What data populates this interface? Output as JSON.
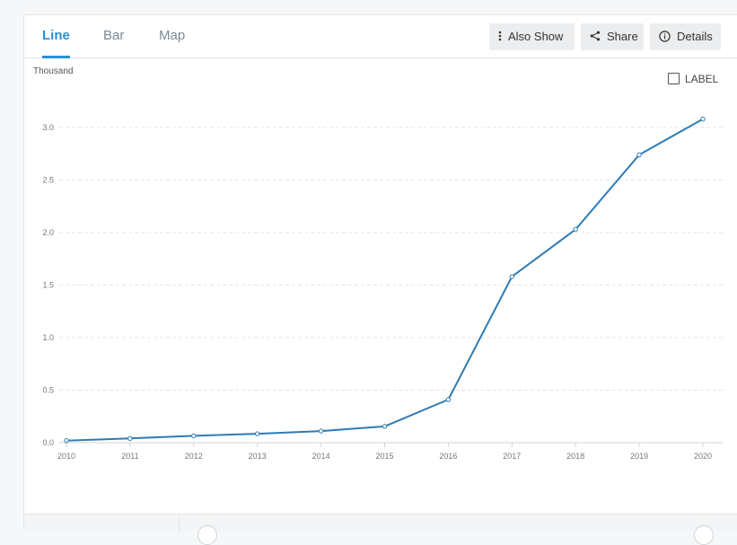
{
  "tabs": [
    {
      "label": "Line",
      "active": true
    },
    {
      "label": "Bar",
      "active": false
    },
    {
      "label": "Map",
      "active": false
    }
  ],
  "toolbar": {
    "also_show_label": "Also Show",
    "also_show_icon": "vertical-dots-icon",
    "share_label": "Share",
    "share_icon": "share-icon",
    "details_label": "Details",
    "details_icon": "info-icon"
  },
  "label_toggle": {
    "label": "LABEL",
    "checked": false
  },
  "chart_data": {
    "type": "line",
    "unit_label": "Thousand",
    "x": [
      "2010",
      "2011",
      "2012",
      "2013",
      "2014",
      "2015",
      "2016",
      "2017",
      "2018",
      "2019",
      "2020"
    ],
    "series": [
      {
        "values": [
          0.02,
          0.04,
          0.065,
          0.085,
          0.11,
          0.155,
          0.41,
          1.58,
          2.03,
          2.74,
          3.08
        ]
      }
    ],
    "yticks": [
      "0.0",
      "0.5",
      "1.0",
      "1.5",
      "2.0",
      "2.5",
      "3.0"
    ],
    "ylim": [
      0,
      3.0
    ],
    "grid": true,
    "line_color": "#2e7bb4"
  }
}
